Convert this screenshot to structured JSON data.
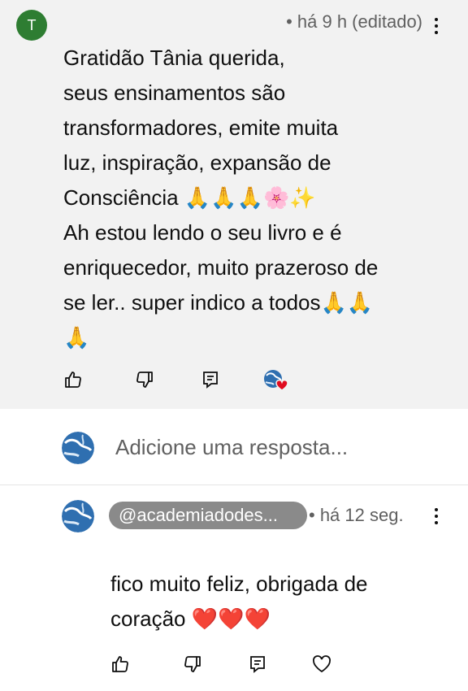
{
  "comment": {
    "avatar_letter": "T",
    "avatar_color": "#2e7d32",
    "meta": "• há 9 h (editado)",
    "body": "Gratidão Tânia querida,\nseus ensinamentos são\ntransformadores, emite muita\nluz, inspiração, expansão de\nConsciência 🙏🙏🙏🌸✨\nAh estou lendo o seu livro e é\nenriquecedor, muito prazeroso de\nse ler.. super indico a todos🙏🙏\n🙏",
    "actions": [
      "thumbs-up-icon",
      "thumbs-down-icon",
      "reply-icon",
      "creator-heart-icon"
    ]
  },
  "reply_box": {
    "placeholder": "Adicione uma resposta..."
  },
  "reply": {
    "handle": "@academiadodes...",
    "meta": "• há 12 seg.",
    "body": "fico muito feliz, obrigada de\ncoração ❤️❤️❤️",
    "actions": [
      "thumbs-up-icon",
      "thumbs-down-icon",
      "reply-icon",
      "heart-outline-icon"
    ]
  }
}
